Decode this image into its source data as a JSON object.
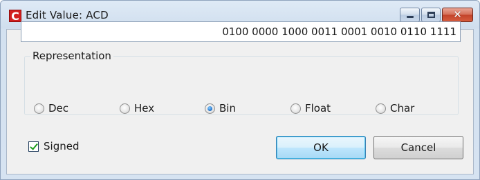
{
  "window": {
    "title": "Edit Value: ACD",
    "app_icon_letter": "C",
    "caption_buttons": [
      "minimize",
      "maximize",
      "close"
    ]
  },
  "value_field": {
    "value": "0100 0000 1000 0011 0001 0010 0110 1111"
  },
  "representation": {
    "legend": "Representation",
    "options": [
      {
        "label": "Dec",
        "checked": false
      },
      {
        "label": "Hex",
        "checked": false
      },
      {
        "label": "Bin",
        "checked": true
      },
      {
        "label": "Float",
        "checked": false
      },
      {
        "label": "Char",
        "checked": false
      }
    ]
  },
  "signed": {
    "label": "Signed",
    "checked": true
  },
  "buttons": {
    "ok_label": "OK",
    "cancel_label": "Cancel"
  },
  "colors": {
    "title_bar": "#dfeaf6",
    "close_button": "#c2432a",
    "checkmark": "#1d9c1d",
    "default_button_border": "#3c7fb1"
  }
}
